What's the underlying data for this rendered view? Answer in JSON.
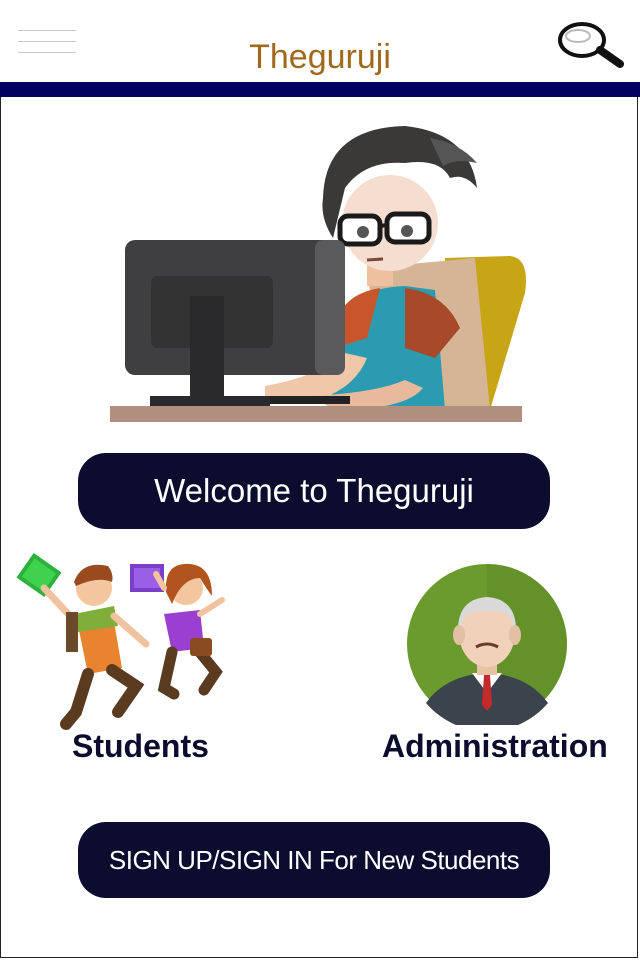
{
  "header": {
    "title": "Theguruji",
    "menu_icon": "hamburger-menu-icon",
    "search_icon": "search-icon",
    "title_color": "#a0691a",
    "accent_bar_color": "#00005e"
  },
  "hero": {
    "illustration": "student-at-computer-illustration"
  },
  "welcome_button": {
    "label": "Welcome to Theguruji"
  },
  "options": [
    {
      "label": "Students",
      "illustration": "students-jumping-illustration"
    },
    {
      "label": "Administration",
      "illustration": "administrator-avatar-illustration"
    }
  ],
  "signup_button": {
    "label": "SIGN UP/SIGN IN For New Students"
  },
  "colors": {
    "button_bg": "#0b0c2e",
    "button_text": "#ffffff"
  }
}
